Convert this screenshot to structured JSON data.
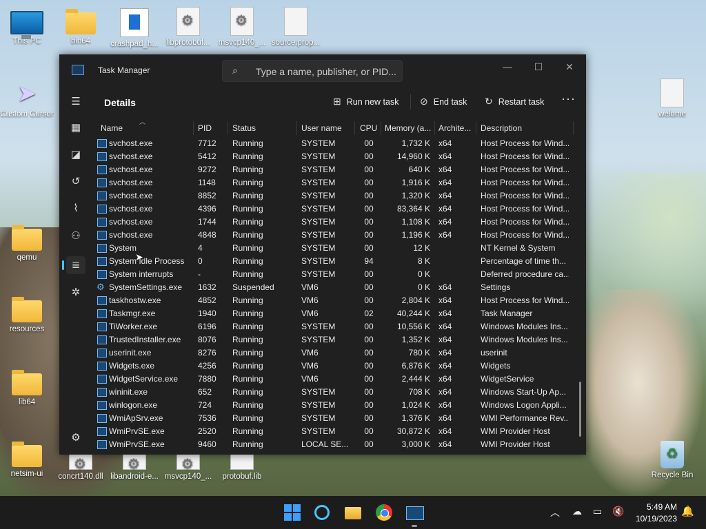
{
  "desktop": {
    "icons": [
      {
        "label": "This PC"
      },
      {
        "label": "bin64"
      },
      {
        "label": "crashpad_h..."
      },
      {
        "label": "libprotobuf..."
      },
      {
        "label": "msvcp140_..."
      },
      {
        "label": "source.prop..."
      },
      {
        "label": "Custom Cursor"
      },
      {
        "label": "qemu"
      },
      {
        "label": "resources"
      },
      {
        "label": "lib64"
      },
      {
        "label": "netsim-ui"
      },
      {
        "label": "concrt140.dll"
      },
      {
        "label": "libandroid-e..."
      },
      {
        "label": "msvcp140_..."
      },
      {
        "label": "protobuf.lib"
      },
      {
        "label": "welome"
      },
      {
        "label": "Recycle Bin"
      }
    ]
  },
  "window": {
    "title": "Task Manager",
    "search_placeholder": "Type a name, publisher, or PID...",
    "controls": {
      "minimize": "—",
      "maximize": "☐",
      "close": "✕"
    }
  },
  "toolbar": {
    "page_title": "Details",
    "run_new_task": "Run new task",
    "end_task": "End task",
    "restart_task": "Restart task",
    "more": "···"
  },
  "columns": {
    "name": "Name",
    "pid": "PID",
    "status": "Status",
    "user": "User name",
    "cpu": "CPU",
    "memory": "Memory (a...",
    "arch": "Archite...",
    "desc": "Description"
  },
  "rows": [
    {
      "name": "svchost.exe",
      "pid": "7712",
      "status": "Running",
      "user": "SYSTEM",
      "cpu": "00",
      "mem": "1,732 K",
      "arch": "x64",
      "desc": "Host Process for Wind..."
    },
    {
      "name": "svchost.exe",
      "pid": "5412",
      "status": "Running",
      "user": "SYSTEM",
      "cpu": "00",
      "mem": "14,960 K",
      "arch": "x64",
      "desc": "Host Process for Wind..."
    },
    {
      "name": "svchost.exe",
      "pid": "9272",
      "status": "Running",
      "user": "SYSTEM",
      "cpu": "00",
      "mem": "640 K",
      "arch": "x64",
      "desc": "Host Process for Wind..."
    },
    {
      "name": "svchost.exe",
      "pid": "1148",
      "status": "Running",
      "user": "SYSTEM",
      "cpu": "00",
      "mem": "1,916 K",
      "arch": "x64",
      "desc": "Host Process for Wind..."
    },
    {
      "name": "svchost.exe",
      "pid": "8852",
      "status": "Running",
      "user": "SYSTEM",
      "cpu": "00",
      "mem": "1,320 K",
      "arch": "x64",
      "desc": "Host Process for Wind..."
    },
    {
      "name": "svchost.exe",
      "pid": "4396",
      "status": "Running",
      "user": "SYSTEM",
      "cpu": "00",
      "mem": "83,364 K",
      "arch": "x64",
      "desc": "Host Process for Wind..."
    },
    {
      "name": "svchost.exe",
      "pid": "1744",
      "status": "Running",
      "user": "SYSTEM",
      "cpu": "00",
      "mem": "1,108 K",
      "arch": "x64",
      "desc": "Host Process for Wind..."
    },
    {
      "name": "svchost.exe",
      "pid": "4848",
      "status": "Running",
      "user": "SYSTEM",
      "cpu": "00",
      "mem": "1,196 K",
      "arch": "x64",
      "desc": "Host Process for Wind..."
    },
    {
      "name": "System",
      "pid": "4",
      "status": "Running",
      "user": "SYSTEM",
      "cpu": "00",
      "mem": "12 K",
      "arch": "",
      "desc": "NT Kernel & System"
    },
    {
      "name": "System Idle Process",
      "pid": "0",
      "status": "Running",
      "user": "SYSTEM",
      "cpu": "94",
      "mem": "8 K",
      "arch": "",
      "desc": "Percentage of time th..."
    },
    {
      "name": "System interrupts",
      "pid": "-",
      "status": "Running",
      "user": "SYSTEM",
      "cpu": "00",
      "mem": "0 K",
      "arch": "",
      "desc": "Deferred procedure ca..."
    },
    {
      "name": "SystemSettings.exe",
      "pid": "1632",
      "status": "Suspended",
      "user": "VM6",
      "cpu": "00",
      "mem": "0 K",
      "arch": "x64",
      "desc": "Settings",
      "icon": "gear"
    },
    {
      "name": "taskhostw.exe",
      "pid": "4852",
      "status": "Running",
      "user": "VM6",
      "cpu": "00",
      "mem": "2,804 K",
      "arch": "x64",
      "desc": "Host Process for Wind..."
    },
    {
      "name": "Taskmgr.exe",
      "pid": "1940",
      "status": "Running",
      "user": "VM6",
      "cpu": "02",
      "mem": "40,244 K",
      "arch": "x64",
      "desc": "Task Manager"
    },
    {
      "name": "TiWorker.exe",
      "pid": "6196",
      "status": "Running",
      "user": "SYSTEM",
      "cpu": "00",
      "mem": "10,556 K",
      "arch": "x64",
      "desc": "Windows Modules Ins..."
    },
    {
      "name": "TrustedInstaller.exe",
      "pid": "8076",
      "status": "Running",
      "user": "SYSTEM",
      "cpu": "00",
      "mem": "1,352 K",
      "arch": "x64",
      "desc": "Windows Modules Ins..."
    },
    {
      "name": "userinit.exe",
      "pid": "8276",
      "status": "Running",
      "user": "VM6",
      "cpu": "00",
      "mem": "780 K",
      "arch": "x64",
      "desc": "userinit"
    },
    {
      "name": "Widgets.exe",
      "pid": "4256",
      "status": "Running",
      "user": "VM6",
      "cpu": "00",
      "mem": "6,876 K",
      "arch": "x64",
      "desc": "Widgets"
    },
    {
      "name": "WidgetService.exe",
      "pid": "7880",
      "status": "Running",
      "user": "VM6",
      "cpu": "00",
      "mem": "2,444 K",
      "arch": "x64",
      "desc": "WidgetService"
    },
    {
      "name": "wininit.exe",
      "pid": "652",
      "status": "Running",
      "user": "SYSTEM",
      "cpu": "00",
      "mem": "708 K",
      "arch": "x64",
      "desc": "Windows Start-Up Ap..."
    },
    {
      "name": "winlogon.exe",
      "pid": "724",
      "status": "Running",
      "user": "SYSTEM",
      "cpu": "00",
      "mem": "1,024 K",
      "arch": "x64",
      "desc": "Windows Logon Appli..."
    },
    {
      "name": "WmiApSrv.exe",
      "pid": "7536",
      "status": "Running",
      "user": "SYSTEM",
      "cpu": "00",
      "mem": "1,376 K",
      "arch": "x64",
      "desc": "WMI Performance Rev..."
    },
    {
      "name": "WmiPrvSE.exe",
      "pid": "2520",
      "status": "Running",
      "user": "SYSTEM",
      "cpu": "00",
      "mem": "30,872 K",
      "arch": "x64",
      "desc": "WMI Provider Host"
    },
    {
      "name": "WmiPrvSE.exe",
      "pid": "9460",
      "status": "Running",
      "user": "LOCAL SE...",
      "cpu": "00",
      "mem": "3,000 K",
      "arch": "x64",
      "desc": "WMI Provider Host"
    }
  ],
  "taskbar": {
    "time": "5:49 AM",
    "date": "10/19/2023"
  },
  "colors": {
    "accent": "#4cc2ff",
    "window_bg": "#202020",
    "taskbar_bg": "#1c1c1c"
  }
}
